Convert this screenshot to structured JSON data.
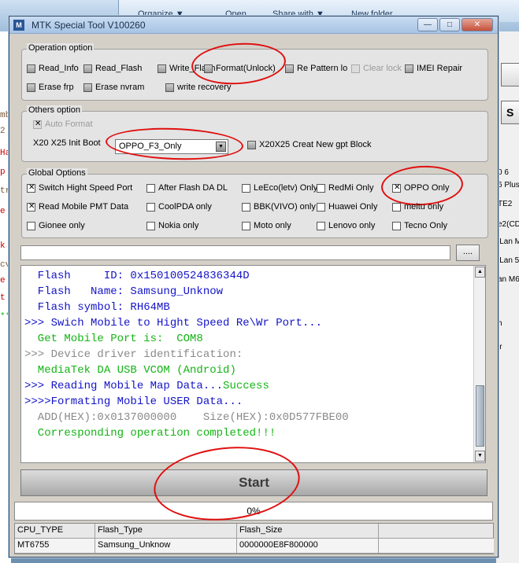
{
  "background": {
    "explorer_toolbar": [
      "Organize ▼",
      "Open",
      "Share with ▼",
      "New folder"
    ],
    "left_console": [
      {
        "text": "mb",
        "color": "#7a5a3a"
      },
      {
        "text": "2",
        "color": "#7a5a3a"
      },
      {
        "text": "Ha",
        "color": "#c80000"
      },
      {
        "text": "p",
        "color": "#c80000"
      },
      {
        "text": "tr",
        "color": "#7a5a3a"
      },
      {
        "text": "e",
        "color": "#c80000"
      },
      {
        "text": "",
        "color": "#000"
      },
      {
        "text": "k",
        "color": "#c80000"
      },
      {
        "text": "cv",
        "color": "#7a5a3a"
      },
      {
        "text": "e",
        "color": "#c80000"
      },
      {
        "text": "t",
        "color": "#c80000"
      },
      {
        "text": "**",
        "color": "#14b414"
      }
    ],
    "right_pane": [
      "0 6",
      "6 Plus",
      "TE2",
      "e2(CD",
      "iLan M",
      "iLan 5",
      "an M6",
      "h",
      "ir"
    ],
    "right_buttons": [
      "",
      "S"
    ]
  },
  "window": {
    "title": "MTK Special Tool V100260",
    "close_label": "✕"
  },
  "operation_option": {
    "legend": "Operation option",
    "items": [
      {
        "label": "Read_Info",
        "checked": false,
        "disabled": false
      },
      {
        "label": "Read_Flash",
        "checked": false,
        "disabled": false
      },
      {
        "label": "Write_Flash",
        "checked": false,
        "disabled": false
      },
      {
        "label": "Format(Unlock)",
        "checked": false,
        "disabled": false
      },
      {
        "label": "Re Pattern lo",
        "checked": false,
        "disabled": false
      },
      {
        "label": "Clear lock",
        "checked": false,
        "disabled": true
      },
      {
        "label": "IMEI Repair",
        "checked": false,
        "disabled": false
      },
      {
        "label": "Erase frp",
        "checked": false,
        "disabled": false
      },
      {
        "label": "Erase nvram",
        "checked": false,
        "disabled": false
      },
      {
        "label": "write recovery",
        "checked": false,
        "disabled": false
      }
    ]
  },
  "others_option": {
    "legend": "Others option",
    "auto_format": "Auto Format",
    "init_boot_label": "X20 X25 Init Boot",
    "init_boot_value": "OPPO_F3_Only",
    "gpt_block": "X20X25 Creat New gpt Block"
  },
  "global_options": {
    "legend": "Global Options",
    "items": [
      {
        "label": "Switch Hight Speed Port",
        "checked": true
      },
      {
        "label": "After Flash DA DL",
        "checked": false
      },
      {
        "label": "LeEco(letv) Only",
        "checked": false
      },
      {
        "label": "RedMi Only",
        "checked": false
      },
      {
        "label": "OPPO Only",
        "checked": true
      },
      {
        "label": "Read Mobile PMT Data",
        "checked": true
      },
      {
        "label": "CoolPDA only",
        "checked": false
      },
      {
        "label": "BBK(VIVO) only",
        "checked": false
      },
      {
        "label": "Huawei Only",
        "checked": false
      },
      {
        "label": "meitu only",
        "checked": false
      },
      {
        "label": "Gionee only",
        "checked": false
      },
      {
        "label": "Nokia only",
        "checked": false
      },
      {
        "label": "Moto only",
        "checked": false
      },
      {
        "label": "Lenovo only",
        "checked": false
      },
      {
        "label": "Tecno Only",
        "checked": false
      }
    ]
  },
  "path": {
    "value": "",
    "browse_label": "...."
  },
  "log": [
    {
      "text": "  Flash     ID: 0x150100524836344D",
      "color": "blue"
    },
    {
      "text": "  Flash   Name: Samsung_Unknow",
      "color": "blue"
    },
    {
      "text": "  Flash symbol: RH64MB",
      "color": "blue"
    },
    {
      "text": ">>> Swich Mobile to Hight Speed Re\\Wr Port...",
      "color": "blue"
    },
    {
      "text": "  Get Mobile Port is:  COM8",
      "color": "green"
    },
    {
      "text": ">>> Device driver identification:",
      "color": "gray"
    },
    {
      "text": "  MediaTek DA USB VCOM (Android)",
      "color": "green"
    },
    {
      "text": ">>> Reading Mobile Map Data...",
      "color": "blue",
      "suffix": "Success"
    },
    {
      "text": ">>>>Formating Mobile USER Data...",
      "color": "blue"
    },
    {
      "text": "  ADD(HEX):0x0137000000    Size(HEX):0x0D577FBE00",
      "color": "gray"
    },
    {
      "text": "  Corresponding operation completed!!!",
      "color": "green"
    }
  ],
  "start_label": "Start",
  "progress": {
    "value": 0,
    "label": "0%"
  },
  "info_table": {
    "headers": [
      "CPU_TYPE",
      "Flash_Type",
      "Flash_Size",
      ""
    ],
    "values": [
      "MT6755",
      "Samsung_Unknow",
      "0000000E8F800000",
      ""
    ]
  },
  "colors": {
    "log_blue": "#1414c8",
    "log_green": "#14b414",
    "log_gray": "#8a8a8a",
    "annotation_red": "#e01010"
  }
}
